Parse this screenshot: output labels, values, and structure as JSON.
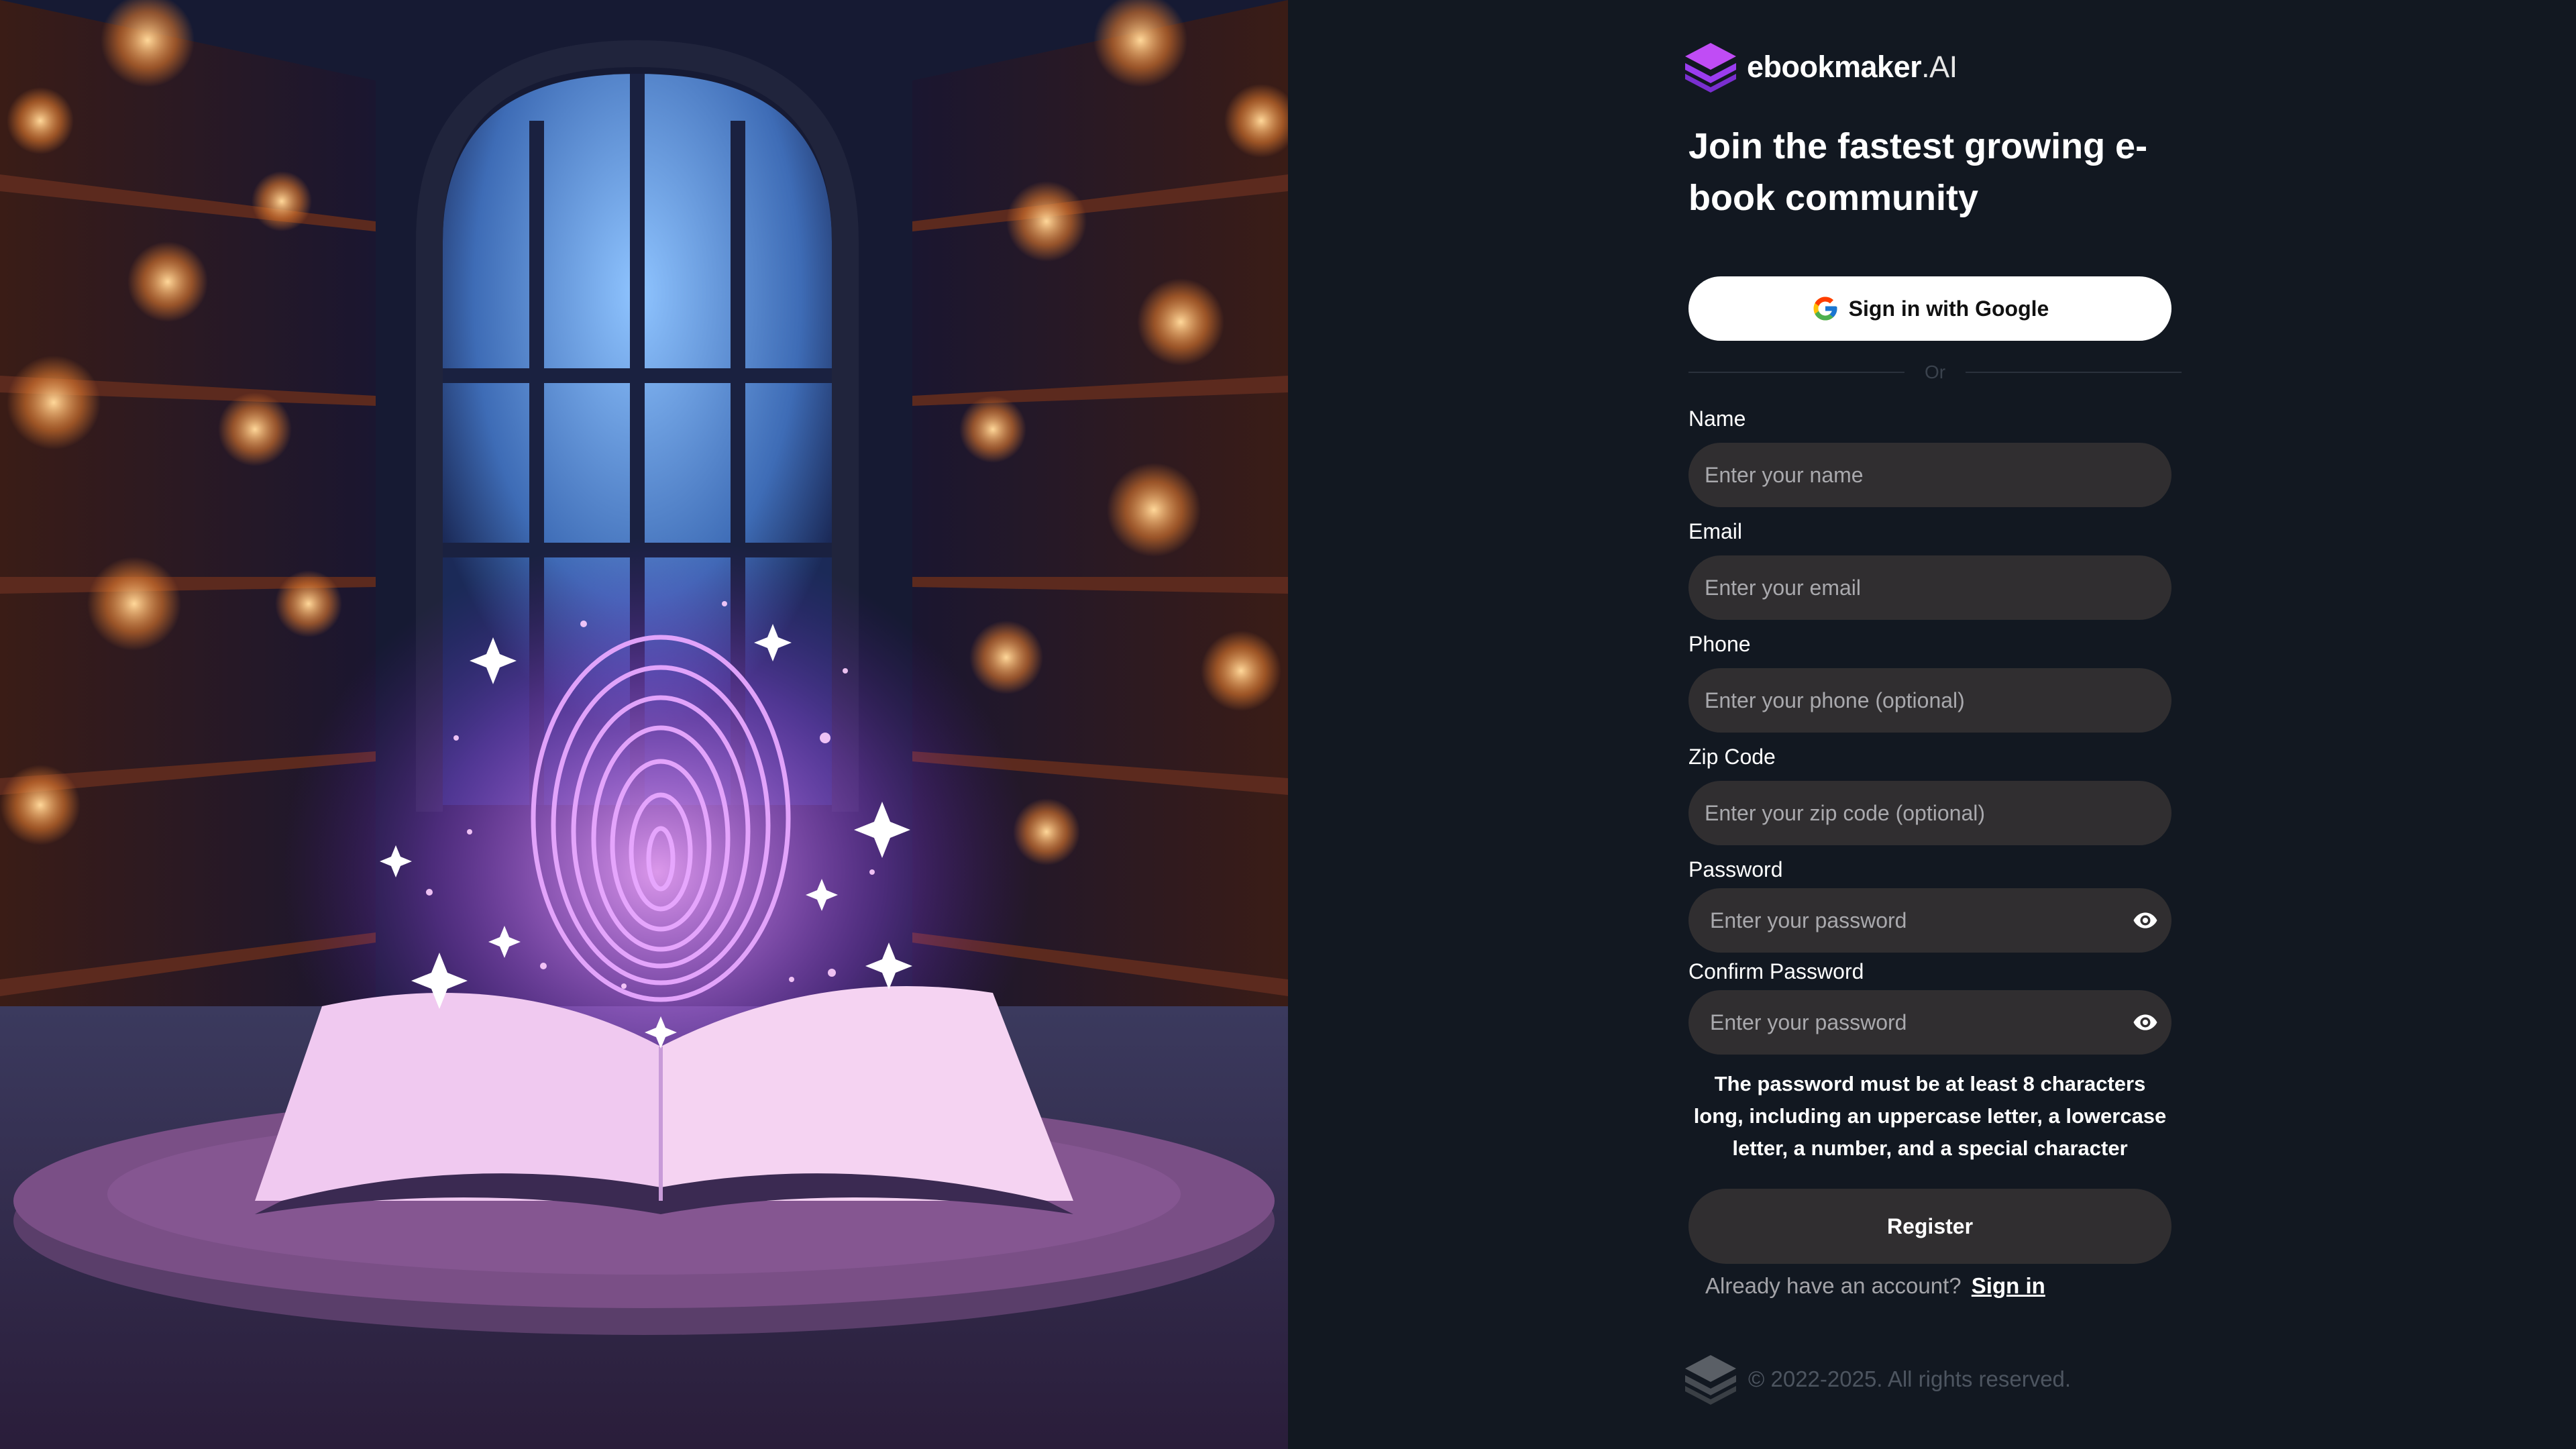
{
  "brand": {
    "name": "ebookmaker",
    "suffix": ".AI"
  },
  "headline": "Join the fastest growing e-book community",
  "google_button": {
    "label": "Sign in with Google",
    "icon": "google-g-icon"
  },
  "divider_text": "Or",
  "fields": {
    "name": {
      "label": "Name",
      "placeholder": "Enter your name"
    },
    "email": {
      "label": "Email",
      "placeholder": "Enter your email"
    },
    "phone": {
      "label": "Phone",
      "placeholder": "Enter your phone (optional)"
    },
    "zip": {
      "label": "Zip Code",
      "placeholder": "Enter your zip code (optional)"
    },
    "password": {
      "label": "Password",
      "placeholder": "Enter your password",
      "icon": "eye-icon"
    },
    "confirm_password": {
      "label": "Confirm Password",
      "placeholder": "Enter your password",
      "icon": "eye-icon"
    }
  },
  "password_rules": "The password must be at least 8 characters long, including an uppercase letter, a lowercase letter, a number, and a special character",
  "register_button": "Register",
  "signin_prompt": {
    "text": "Already have an account?",
    "link": "Sign in"
  },
  "footer": {
    "copyright": "© 2022-2025. All rights reserved."
  },
  "colors": {
    "panel_bg": "#121821",
    "input_bg": "#302e30",
    "brand_purple": "#9b3df0",
    "hero_glow": "#e07bff"
  }
}
